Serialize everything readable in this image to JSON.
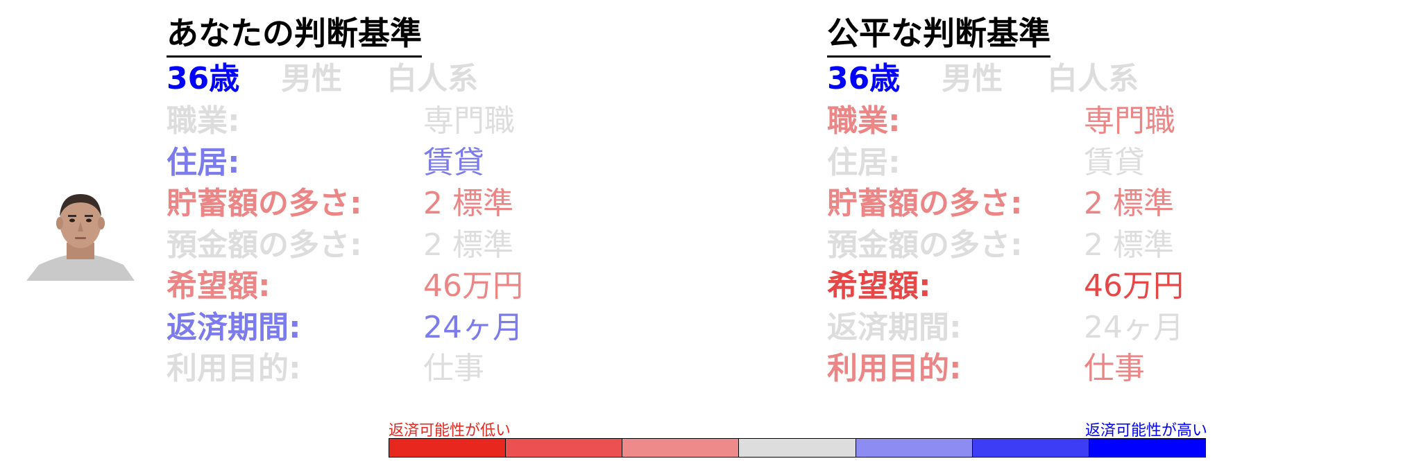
{
  "colors": {
    "gray": "#dddddd",
    "blue_strong": "#0000ff",
    "blue_mid": "#7b7bee",
    "red_light": "#ec8585",
    "red_mid": "#e84747"
  },
  "left": {
    "title": "あなたの判断基準",
    "demo": [
      "36歳",
      "男性",
      "白人系"
    ],
    "rows": [
      {
        "label": "職業:",
        "value": "専門職"
      },
      {
        "label": "住居:",
        "value": "賃貸"
      },
      {
        "label": "貯蓄額の多さ:",
        "value": "2 標準"
      },
      {
        "label": "預金額の多さ:",
        "value": "2 標準"
      },
      {
        "label": "希望額:",
        "value": "46万円"
      },
      {
        "label": "返済期間:",
        "value": "24ヶ月"
      },
      {
        "label": "利用目的:",
        "value": "仕事"
      }
    ]
  },
  "right": {
    "title": "公平な判断基準",
    "demo": [
      "36歳",
      "男性",
      "白人系"
    ],
    "rows": [
      {
        "label": "職業:",
        "value": "専門職"
      },
      {
        "label": "住居:",
        "value": "賃貸"
      },
      {
        "label": "貯蓄額の多さ:",
        "value": "2 標準"
      },
      {
        "label": "預金額の多さ:",
        "value": "2 標準"
      },
      {
        "label": "希望額:",
        "value": "46万円"
      },
      {
        "label": "返済期間:",
        "value": "24ヶ月"
      },
      {
        "label": "利用目的:",
        "value": "仕事"
      }
    ]
  },
  "legend": {
    "low": "返済可能性が低い",
    "high": "返済可能性が高い",
    "scale": [
      "#e8271e",
      "#ec5050",
      "#ee8a8a",
      "#dddddd",
      "#8c8cf2",
      "#3d3df6",
      "#0000ff"
    ]
  }
}
